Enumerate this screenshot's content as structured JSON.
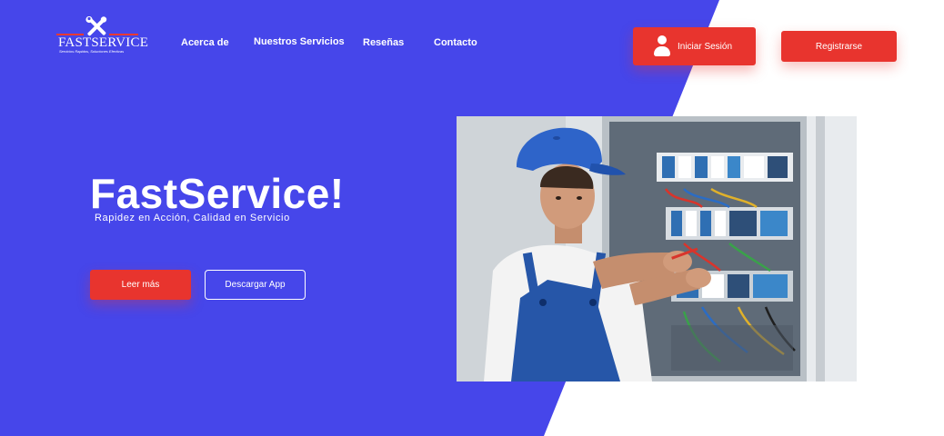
{
  "brand": {
    "name": "FASTSERVICE",
    "tagline": "Servicios Rapidos, Soluciones Efectivas",
    "colors": {
      "primary": "#4646ea",
      "accent": "#e8342e",
      "white": "#ffffff"
    }
  },
  "nav": {
    "items": [
      {
        "label": "Acerca de"
      },
      {
        "label": "Nuestros Servicios"
      },
      {
        "label": "Reseñas"
      },
      {
        "label": "Contacto"
      }
    ]
  },
  "header": {
    "login_label": "Iniciar Sesión",
    "register_label": "Registrarse"
  },
  "hero": {
    "title": "FastService!",
    "subtitle": "Rapidez en Acción, Calidad en Servicio",
    "primary_button": "Leer más",
    "secondary_button": "Descargar App"
  },
  "icons": {
    "logo": "wrench-screwdriver-icon",
    "login": "user-icon"
  }
}
